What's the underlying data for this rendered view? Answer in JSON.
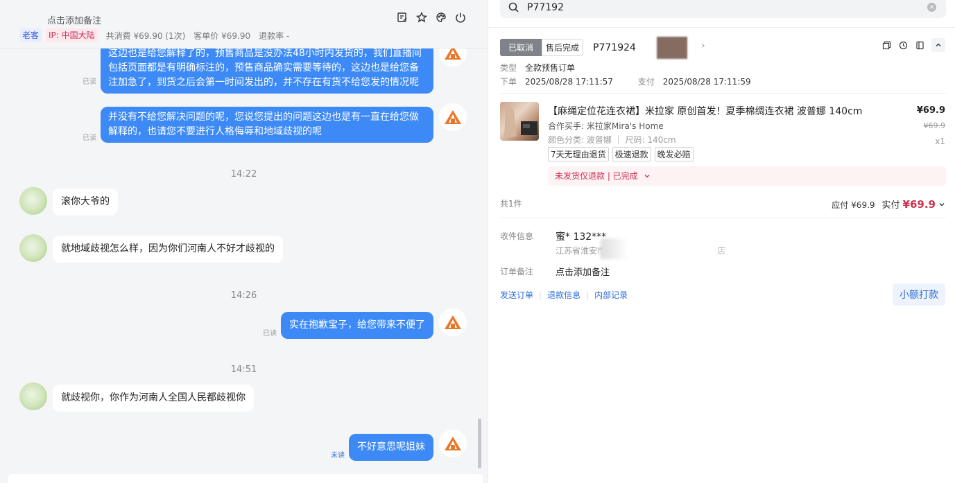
{
  "chat": {
    "header": {
      "note_link": "点击添加备注",
      "tag_old": "老客",
      "tag_ip": "IP: 中国大陆",
      "total_spent": "共消费 ¥69.90 (1次)",
      "avg_price": "客单价 ¥69.90",
      "refund_rate": "退款率 -"
    },
    "messages": [
      {
        "text": "这边也是给您解释了的，预售商品是没办法48小时内发货的，我们直播间包括页面都是有明确标注的，预售商品确实需要等待的，这边也是给您备注加急了，到货之后会第一时间发出的，并不存在有货不给您发的情况呢",
        "status": "已读"
      },
      {
        "text": "并没有不给您解决问题的呢，您说您提出的问题这边也是有一直在给您做解释的，也请您不要进行人格侮辱和地域歧视的呢",
        "status": "已读"
      },
      {
        "time": "14:22"
      },
      {
        "text": "滚你大爷的"
      },
      {
        "text": "就地域歧视怎么样，因为你们河南人不好才歧视的"
      },
      {
        "time": "14:26"
      },
      {
        "text": "实在抱歉宝子，给您带来不便了",
        "status": "已读"
      },
      {
        "time": "14:51"
      },
      {
        "text": "就歧视你，你作为河南人全国人民都歧视你"
      },
      {
        "text": "不好意思呢姐妹",
        "status": "未读"
      }
    ]
  },
  "order": {
    "search_value": "P77192",
    "status_cancelled": "已取消",
    "status_after_sale": "售后完成",
    "order_no": "P771924",
    "type_label": "类型",
    "type_value": "全款预售订单",
    "placed_label": "下单",
    "placed_value": "2025/08/28 17:11:57",
    "paid_label": "支付",
    "paid_value": "2025/08/28 17:11:59",
    "product": {
      "title": "【麻绳定位花连衣裙】米拉家 原创首发！夏季棉绸连衣裙 波普娜 140cm",
      "partner": "合作买手: 米拉家Mira's Home",
      "spec": "颜色分类: 波普娜 ｜ 尺码: 140cm",
      "price": "¥69.9",
      "orig_price": "¥69.9",
      "qty": "x1",
      "badges": [
        "7天无理由退货",
        "极速退款",
        "晚发必赔"
      ],
      "refund_status": "未发货仅退款 | 已完成"
    },
    "count_text": "共1件",
    "payable_label": "应付",
    "payable_value": "¥69.9",
    "paid_actual_label": "实付",
    "paid_actual_value": "¥69.9",
    "receiver_label": "收件信息",
    "receiver_name": "蜜* 132***",
    "receiver_addr": "江苏省淮安市清",
    "receiver_addr_tail": "店",
    "remark_label": "订单备注",
    "remark_value": "点击添加备注",
    "links": [
      "发送订单",
      "退款信息",
      "内部记录"
    ],
    "small_pay_button": "小额打款"
  }
}
